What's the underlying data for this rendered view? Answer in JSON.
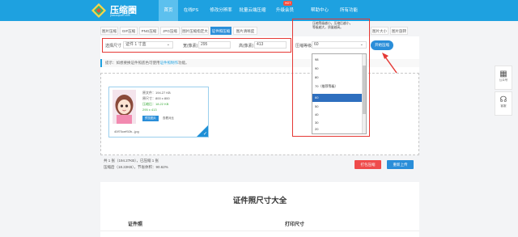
{
  "header": {
    "brand": "压缩圈",
    "brand_sub": "yasuoquan.com",
    "nav": [
      "首页",
      "在线PS",
      "修改分辨率",
      "批量云端压缩",
      "升级会员",
      "帮助中心",
      "所有功能"
    ],
    "hot_badge": "HOT"
  },
  "tabs": [
    "图片压缩",
    "GIF压缩",
    "PNG压缩",
    "JPG压缩",
    "图片压缩指定大小",
    "证件照压缩",
    "图片清晰度",
    "",
    "",
    "图片大小",
    "图片旋转"
  ],
  "controls": {
    "size_label": "选择尺寸",
    "size_value": "证件 1 寸蓝",
    "width_label": "宽(像素)",
    "width_value": "295",
    "height_label": "高(像素)",
    "height_value": "413",
    "compress_level_label": "压缩等级",
    "compress_level_value": "60",
    "start_button": "开始压缩"
  },
  "dropdown_hint": [
    "压缩等级越小，压缩后越小，",
    "等级越大，质量越高。"
  ],
  "hint": {
    "text": "提示：如想要换证件照底色可使用",
    "link": "证件照制作",
    "suffix": "功能。"
  },
  "file_card": {
    "original_size": "原文件：194.27 KB",
    "original_dim": "原尺寸：800 x 800",
    "compressed_size": "压缩后：18.22 KB",
    "compressed_dim": "295 x 413",
    "preview_button": "预览图片",
    "view_label": "查看对比",
    "filename": "40f70cef92b...jpg"
  },
  "summary": {
    "line1": "共 1 张（194.27KB），已压缩 1 张",
    "line2": "压缩后（18.22KB），节省体积：90.62%"
  },
  "buttons": {
    "download": "打包压缩",
    "reupload": "重新上传"
  },
  "bottom": {
    "title": "证件照尺寸大全",
    "col1": "证件照",
    "col2": "打印尺寸"
  },
  "dropdown_options": [
    "98",
    "90",
    "80",
    "70（推荐等级）",
    "60",
    "50",
    "40",
    "30",
    "20",
    "10"
  ],
  "dropdown_selected_index": 4,
  "sidebar": [
    "公众号",
    "客服"
  ],
  "colors": {
    "accent": "#1ea1e0",
    "highlight": "#e53935",
    "selected": "#2e6fbf"
  }
}
